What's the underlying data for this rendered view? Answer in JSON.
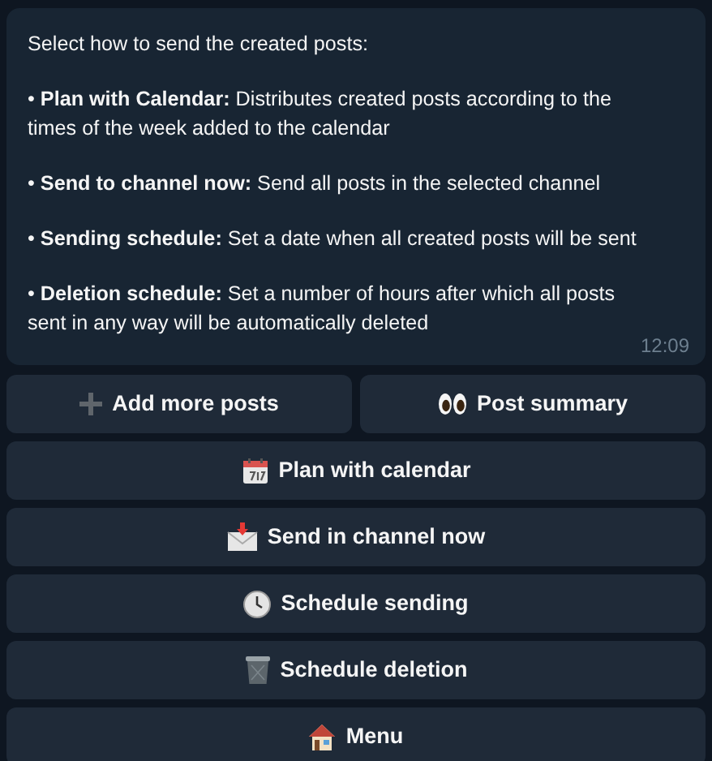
{
  "message": {
    "paragraphs": [
      "Select how to send the created posts:",
      "• **Plan with Calendar:** Distributes created posts according to the times of the week added to the calendar",
      "• **Send to channel now:** Send all posts in the selected channel",
      "• **Sending schedule:** Set a date when all created posts will be sent",
      "• **Deletion schedule:** Set a number of hours after which all posts sent in any way will be automatically deleted"
    ],
    "time": "12:09"
  },
  "keyboard": [
    [
      {
        "label": "Add more posts"
      },
      {
        "label": "Post summary"
      }
    ],
    [
      {
        "label": "Plan with calendar"
      }
    ],
    [
      {
        "label": "Send in channel now"
      }
    ],
    [
      {
        "label": "Schedule sending"
      }
    ],
    [
      {
        "label": "Schedule deletion"
      }
    ],
    [
      {
        "label": "Menu"
      }
    ]
  ]
}
